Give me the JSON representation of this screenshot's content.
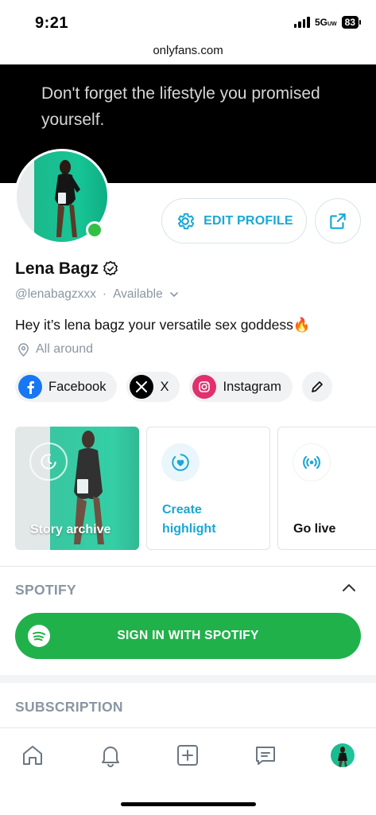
{
  "status_bar": {
    "time": "9:21",
    "network": "5G",
    "network_suffix": "UW",
    "battery": "83"
  },
  "browser": {
    "url": "onlyfans.com"
  },
  "banner": {
    "text": "Don't forget the lifestyle you promised yourself."
  },
  "profile": {
    "name": "Lena Bagz",
    "handle": "@lenabagzxxx",
    "separator": "·",
    "status": "Available",
    "bio": "Hey it’s lena bagz your versatile sex goddess🔥",
    "location": "All around",
    "online": true
  },
  "actions": {
    "edit_profile": "EDIT PROFILE"
  },
  "social": [
    {
      "label": "Facebook",
      "icon": "facebook-icon",
      "color": "#1877f2"
    },
    {
      "label": "X",
      "icon": "x-icon",
      "color": "#000000"
    },
    {
      "label": "Instagram",
      "icon": "instagram-icon",
      "color": "#e1306c"
    }
  ],
  "stories": {
    "archive": "Story archive",
    "highlight": "Create highlight",
    "live": "Go live"
  },
  "spotify": {
    "title": "SPOTIFY",
    "button": "SIGN IN WITH SPOTIFY"
  },
  "subscription": {
    "title": "SUBSCRIPTION"
  },
  "colors": {
    "accent": "#1aa7d6",
    "spotify_green": "#21b14b",
    "muted": "#8a96a3",
    "online": "#34c046"
  }
}
